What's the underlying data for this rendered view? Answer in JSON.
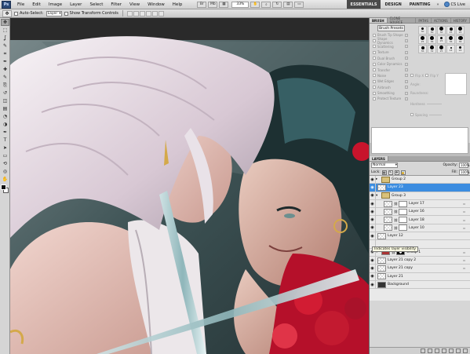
{
  "app": {
    "logo": "Ps",
    "menu": [
      "File",
      "Edit",
      "Image",
      "Layer",
      "Select",
      "Filter",
      "View",
      "Window",
      "Help"
    ],
    "zoom": "33%"
  },
  "workspace": {
    "items": [
      "ESSENTIALS",
      "DESIGN",
      "PAINTING"
    ],
    "more": "»",
    "cs_live": "CS Live"
  },
  "options": {
    "auto_select_label": "Auto-Select:",
    "auto_select_value": "Layer",
    "transform_label": "Show Transform Controls"
  },
  "tools": [
    "move-tool-icon",
    "marquee-tool-icon",
    "lasso-tool-icon",
    "quick-select-icon",
    "crop-tool-icon",
    "eyedropper-icon",
    "healing-brush-icon",
    "brush-tool-icon",
    "clone-stamp-icon",
    "history-brush-icon",
    "eraser-icon",
    "gradient-icon",
    "blur-tool-icon",
    "dodge-tool-icon",
    "pen-tool-icon",
    "type-tool-icon",
    "path-select-icon",
    "shape-tool-icon",
    "3d-rotate-icon",
    "3d-orbit-icon",
    "hand-tool-icon",
    "zoom-tool-icon"
  ],
  "brush_panel": {
    "tabs": [
      "BRUSH",
      "CLONE SOURCE",
      "PATHS",
      "ACTIONS",
      "HISTORY"
    ],
    "presets_button": "Brush Presets",
    "options": [
      "Brush Tip Shape",
      "Shape Dynamics",
      "Scattering",
      "Texture",
      "Dual Brush",
      "Color Dynamics",
      "Transfer",
      "Noise",
      "Wet Edges",
      "Airbrush",
      "Smoothing",
      "Protect Texture"
    ],
    "tips": [
      {
        "size": "30",
        "d": 3
      },
      {
        "size": "30",
        "d": 4
      },
      {
        "size": "30",
        "d": 5
      },
      {
        "size": "25",
        "d": 4
      },
      {
        "size": "25",
        "d": 5
      },
      {
        "size": "25",
        "d": 5
      },
      {
        "size": "36",
        "d": 5
      },
      {
        "size": "25",
        "d": 3
      },
      {
        "size": "36",
        "d": 5
      },
      {
        "size": "36",
        "d": 6
      },
      {
        "size": "36",
        "d": 4
      },
      {
        "size": "32",
        "d": 5
      },
      {
        "size": "25",
        "d": 5
      },
      {
        "size": "14",
        "d": 2
      },
      {
        "size": "24",
        "d": 3
      }
    ],
    "flip_x": "Flip X",
    "flip_y": "Flip Y",
    "angle": "Angle:",
    "roundness": "Roundness:",
    "hardness": "Hardness",
    "spacing": "Spacing"
  },
  "layers_panel": {
    "tabs": [
      "LAYERS"
    ],
    "blend_mode": "Normal",
    "opacity_label": "Opacity:",
    "opacity": "100%",
    "lock_label": "Lock:",
    "fill_label": "Fill:",
    "fill": "100%",
    "tooltip": "Indicates layer visibility",
    "layers": [
      {
        "name": "Group 2",
        "type": "group",
        "indent": 0,
        "collapsed": true
      },
      {
        "name": "Layer 23",
        "type": "layer",
        "indent": 0,
        "selected": true
      },
      {
        "name": "Group 3",
        "type": "group",
        "indent": 0,
        "collapsed": false
      },
      {
        "name": "Layer 17",
        "type": "masked",
        "indent": 1
      },
      {
        "name": "Layer 16",
        "type": "masked",
        "indent": 1
      },
      {
        "name": "Layer 18",
        "type": "masked",
        "indent": 1
      },
      {
        "name": "Layer 10",
        "type": "masked",
        "indent": 1
      },
      {
        "name": "Layer 12",
        "type": "layer",
        "indent": 0
      },
      {
        "name": "",
        "type": "spacer",
        "indent": 0
      },
      {
        "name": "Group 1",
        "type": "group-mask",
        "indent": 0
      },
      {
        "name": "Layer 21 copy 2",
        "type": "layer",
        "indent": 0
      },
      {
        "name": "Layer 21 copy",
        "type": "layer",
        "indent": 0
      },
      {
        "name": "Layer 21",
        "type": "layer",
        "indent": 0
      },
      {
        "name": "Background",
        "type": "background",
        "indent": 0
      }
    ]
  },
  "colors": {
    "selection": "#3b8ce0",
    "ws_active_bg": "#4a4a4a"
  }
}
